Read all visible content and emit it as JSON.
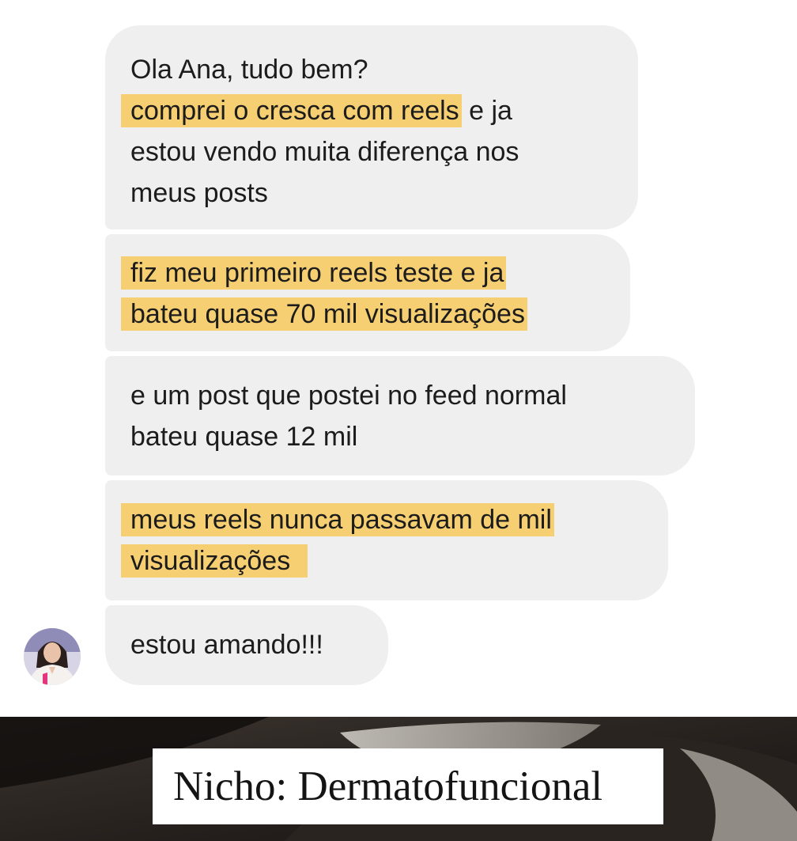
{
  "messages": [
    {
      "lines": [
        {
          "highlight": "",
          "text": "Ola Ana, tudo bem?"
        },
        {
          "highlight": "comprei o cresca com reels",
          "text": " e ja"
        },
        {
          "highlight": "",
          "text": "estou vendo muita diferença nos"
        },
        {
          "highlight": "",
          "text": "meus posts"
        }
      ]
    },
    {
      "lines": [
        {
          "highlight": "fiz meu primeiro reels teste e ja",
          "text": ""
        },
        {
          "highlight": "bateu quase 70 mil visualizações",
          "text": ""
        }
      ]
    },
    {
      "lines": [
        {
          "highlight": "",
          "text": "e um post que postei no feed normal"
        },
        {
          "highlight": "",
          "text": "bateu quase 12 mil"
        }
      ]
    },
    {
      "lines": [
        {
          "highlight": "meus reels nunca passavam de mil",
          "text": ""
        },
        {
          "highlight": "visualizações",
          "text": ""
        }
      ]
    },
    {
      "lines": [
        {
          "highlight": "",
          "text": "estou amando!!!"
        }
      ]
    }
  ],
  "caption": {
    "text": "Nicho: Dermatofuncional"
  },
  "colors": {
    "bubble": "#efefef",
    "highlight": "#f7cf73",
    "text": "#1c1c1c"
  },
  "icons": {
    "avatar": "sender-avatar"
  }
}
